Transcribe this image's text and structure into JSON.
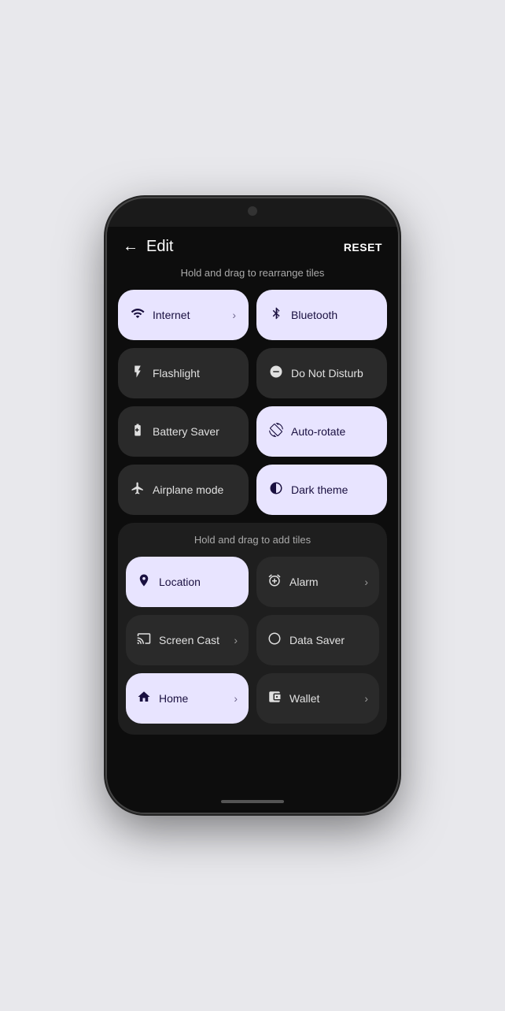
{
  "header": {
    "back_label": "←",
    "title": "Edit",
    "reset_label": "RESET"
  },
  "sections": {
    "active_hint": "Hold and drag to rearrange tiles",
    "add_hint": "Hold and drag to add tiles"
  },
  "active_tiles": [
    {
      "id": "internet",
      "icon": "wifi",
      "label": "Internet",
      "state": "active",
      "has_arrow": true
    },
    {
      "id": "bluetooth",
      "icon": "bluetooth",
      "label": "Bluetooth",
      "state": "active",
      "has_arrow": false
    },
    {
      "id": "flashlight",
      "icon": "flashlight",
      "label": "Flashlight",
      "state": "inactive",
      "has_arrow": false
    },
    {
      "id": "do-not-disturb",
      "icon": "dnd",
      "label": "Do Not Disturb",
      "state": "inactive",
      "has_arrow": false
    },
    {
      "id": "battery-saver",
      "icon": "battery",
      "label": "Battery Saver",
      "state": "inactive",
      "has_arrow": false
    },
    {
      "id": "auto-rotate",
      "icon": "rotate",
      "label": "Auto-rotate",
      "state": "active",
      "has_arrow": false
    },
    {
      "id": "airplane-mode",
      "icon": "airplane",
      "label": "Airplane mode",
      "state": "inactive",
      "has_arrow": false
    },
    {
      "id": "dark-theme",
      "icon": "dark",
      "label": "Dark theme",
      "state": "active",
      "has_arrow": false
    }
  ],
  "add_tiles": [
    {
      "id": "location",
      "icon": "location",
      "label": "Location",
      "state": "active",
      "has_arrow": false
    },
    {
      "id": "alarm",
      "icon": "alarm",
      "label": "Alarm",
      "state": "inactive",
      "has_arrow": true
    },
    {
      "id": "screen-cast",
      "icon": "cast",
      "label": "Screen Cast",
      "state": "inactive",
      "has_arrow": true
    },
    {
      "id": "data-saver",
      "icon": "datasaver",
      "label": "Data Saver",
      "state": "inactive",
      "has_arrow": false
    },
    {
      "id": "home",
      "icon": "home",
      "label": "Home",
      "state": "active",
      "has_arrow": true
    },
    {
      "id": "wallet",
      "icon": "wallet",
      "label": "Wallet",
      "state": "inactive",
      "has_arrow": true
    }
  ],
  "icons": {
    "wifi": "▼",
    "bluetooth": "✱",
    "flashlight": "🔦",
    "dnd": "⊖",
    "battery": "🔋",
    "rotate": "↺",
    "airplane": "✈",
    "dark": "◑",
    "location": "◎",
    "alarm": "⏰",
    "cast": "▭",
    "datasaver": "○",
    "home": "⌂",
    "wallet": "▭"
  }
}
